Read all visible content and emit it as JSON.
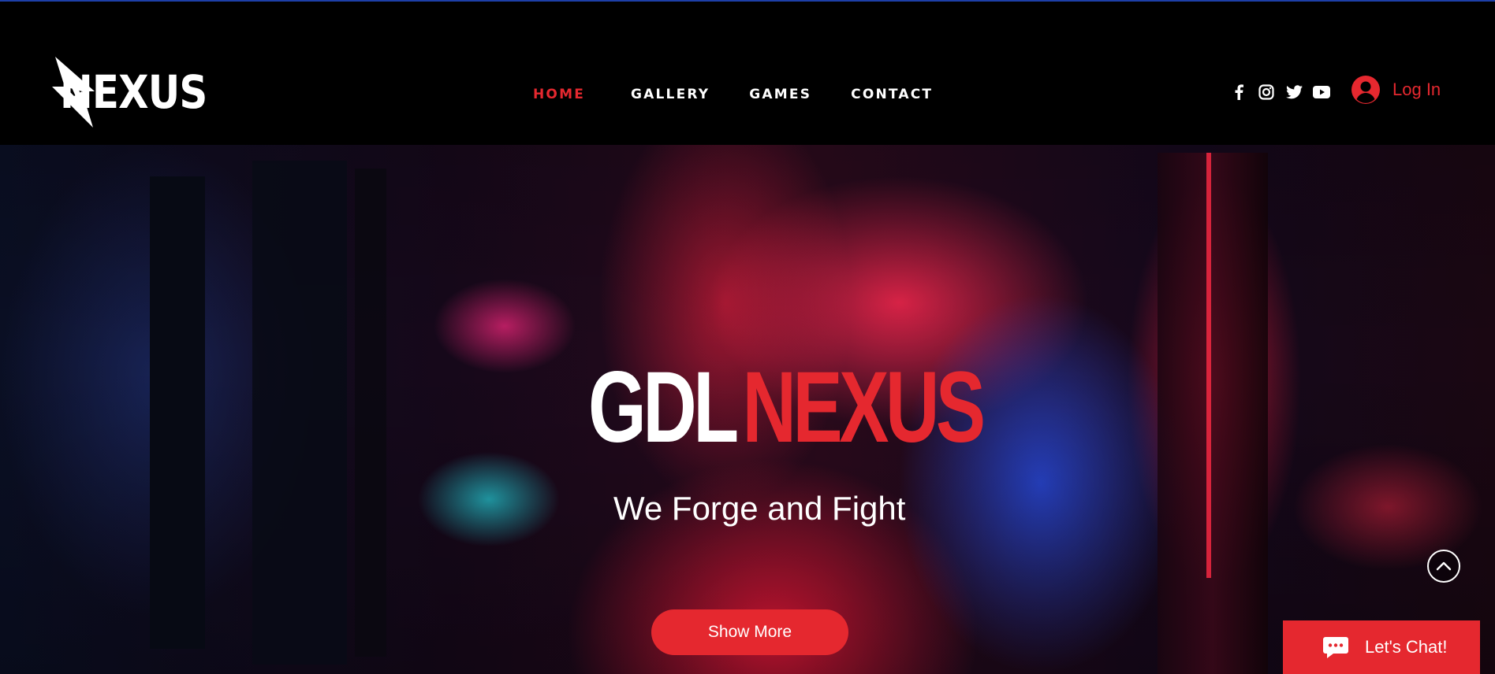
{
  "brand": {
    "logo_text": "NEXUS",
    "accent_color": "#e5282f",
    "topline_color": "#1d3fa8"
  },
  "nav": {
    "items": [
      {
        "label": "HOME",
        "active": true
      },
      {
        "label": "GALLERY",
        "active": false
      },
      {
        "label": "GAMES",
        "active": false
      },
      {
        "label": "CONTACT",
        "active": false
      }
    ]
  },
  "social": {
    "icons": [
      "facebook-icon",
      "instagram-icon",
      "twitter-icon",
      "youtube-icon"
    ]
  },
  "login": {
    "label": "Log In",
    "icon": "user-avatar-icon"
  },
  "hero": {
    "title_part_a": "GDL",
    "title_part_b": "NEXUS",
    "tagline": "We Forge and Fight",
    "cta_label": "Show More"
  },
  "scroll_top": {
    "icon": "chevron-up-icon"
  },
  "chat": {
    "label": "Let's Chat!",
    "icon": "chat-bubble-icon"
  }
}
